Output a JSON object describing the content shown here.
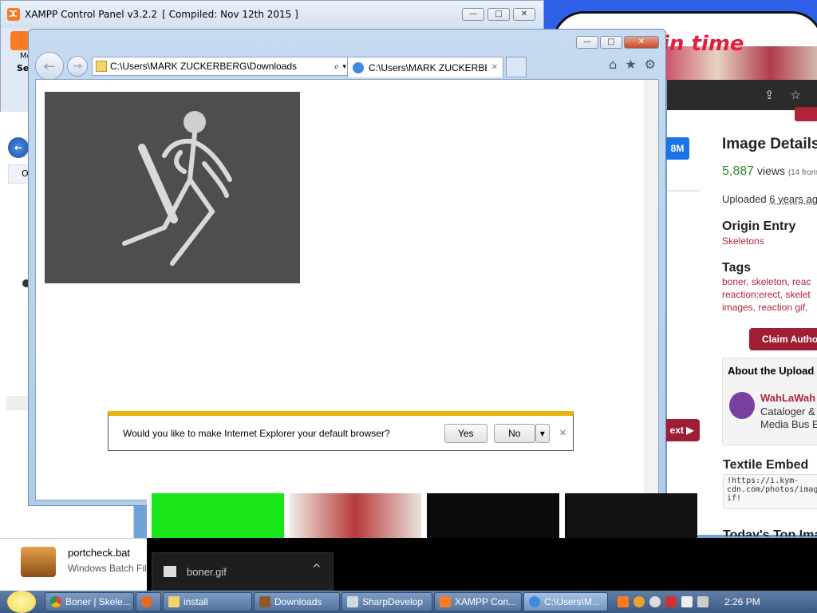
{
  "xampp": {
    "title": "XAMPP Control Panel v3.2.2",
    "compiled": "[ Compiled: Nov 12th 2015 ]",
    "minimize": "—",
    "maximize": "□",
    "close": "✕",
    "side_labels": [
      "Mo",
      "Se"
    ]
  },
  "cartoon": {
    "title": "in time"
  },
  "ie": {
    "address": "C:\\Users\\MARK ZUCKERBERG\\Downloads",
    "tab_title": "C:\\Users\\MARK ZUCKERBE...",
    "tab_close": "✕",
    "search_icon": "⌕",
    "refresh_icon": "↻",
    "stop_icon": "✕",
    "home_icon": "⌂",
    "favorites_icon": "★",
    "tools_icon": "⚙",
    "back_icon": "←",
    "forward_icon": "→",
    "minimize": "—",
    "maximize": "□",
    "close": "✕"
  },
  "notify": {
    "question": "Would you like to make Internet Explorer your default browser?",
    "yes": "Yes",
    "no": "No",
    "dropdown": "▾",
    "close": "✕"
  },
  "kym": {
    "size_btn": "8M",
    "image_details": "Image Details",
    "views_count": "5,887",
    "views_label": "views",
    "views_from": "(14 from",
    "uploaded_label": "Uploaded",
    "uploaded_value": "6 years ag",
    "origin_title": "Origin Entry",
    "origin_link": "Skeletons",
    "tags_title": "Tags",
    "tags_lines": [
      "boner, skeleton, reac",
      "reaction:erect, skelet",
      "images, reaction gif,"
    ],
    "claim_btn": "Claim Autho",
    "about_uploader": "About the Upload",
    "uploader_name": "WahLaWah",
    "uploader_role1": "Cataloger &",
    "uploader_role2": "Media Bus E",
    "next_btn": "ext ▶",
    "textile_title": "Textile Embed",
    "textile_lines": [
      "!https://i.kym-",
      "cdn.com/photos/imag",
      "if!"
    ],
    "today_top": "Today's Top Ima"
  },
  "explorer": {
    "portcheck_name": "portcheck.bat",
    "portcheck_type": "Windows Batch Fil",
    "side_label": "O"
  },
  "download": {
    "file": "boner.gif",
    "chevron": "^"
  },
  "taskbar": {
    "items": [
      {
        "label": "Boner | Skele...",
        "color": "#e0b020"
      },
      {
        "label": "",
        "color": "#e86a1a"
      },
      {
        "label": "install",
        "color": "#f3d36b"
      },
      {
        "label": "Downloads",
        "color": "#8b5a2b"
      },
      {
        "label": "SharpDevelop",
        "color": "#cfd8e3"
      },
      {
        "label": "XAMPP Con...",
        "color": "#fb7a24"
      },
      {
        "label": "C:\\Users\\M...",
        "color": "#3d8ae0"
      }
    ],
    "clock": "2:26 PM"
  },
  "colors": {
    "kym_red": "#b0243a",
    "ie_blue": "#c6daf1",
    "notify_yellow": "#e8b40a"
  }
}
